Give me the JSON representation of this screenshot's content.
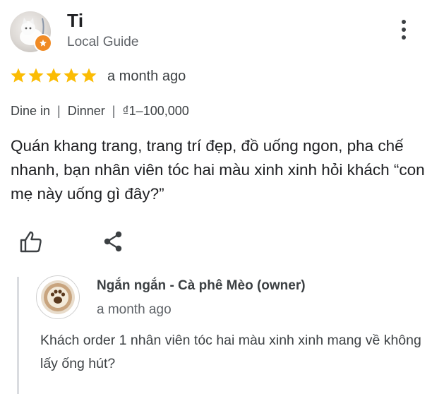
{
  "reviewer": {
    "name": "Ti",
    "subtitle": "Local Guide"
  },
  "review": {
    "rating": 5,
    "max_rating": 5,
    "time": "a month ago",
    "tags": [
      "Dine in",
      "Dinner",
      "₫1–100,000"
    ],
    "separator": "|",
    "text": "Quán khang trang, trang trí đẹp, đồ uống ngon, pha chế nhanh, bạn nhân viên tóc hai màu xinh xinh hỏi khách “con mẹ này uống gì đây?”"
  },
  "actions": {
    "like_icon": "thumbs-up-icon",
    "share_icon": "share-icon",
    "more_icon": "more-vert-icon"
  },
  "owner_reply": {
    "name": "Ngắn ngắn - Cà phê Mèo (owner)",
    "time": "a month ago",
    "text": "Khách order 1 nhân viên tóc hai màu xinh xinh mang về không lấy ống hút?"
  },
  "colors": {
    "star": "#fbbc04",
    "badge": "#f08a24",
    "text": "#202124",
    "secondary": "#5f6368"
  }
}
